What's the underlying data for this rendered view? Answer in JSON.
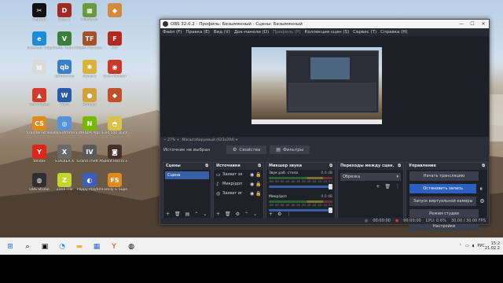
{
  "desktop": {
    "icons": [
      {
        "label": "CapCut",
        "color": "#111111",
        "glyph": "✂"
      },
      {
        "label": "Dota 2",
        "color": "#a02a23",
        "glyph": "D"
      },
      {
        "label": "Minecraft",
        "color": "#6b9a3d",
        "glyph": "▦"
      },
      {
        "label": "",
        "color": "#d38a3e",
        "glyph": "◆"
      },
      {
        "label": "Microsoft Edge",
        "color": "#1d8bd6",
        "glyph": "e"
      },
      {
        "label": "Grand Theft Auto V",
        "color": "#3a7f3d",
        "glyph": "V"
      },
      {
        "label": "Team Fortress 2",
        "color": "#a5512a",
        "glyph": "TF"
      },
      {
        "label": "F2F",
        "color": "#b2291f",
        "glyph": "F"
      },
      {
        "label": "",
        "color": "#d9d9d9",
        "glyph": "▤"
      },
      {
        "label": "qBittorrent",
        "color": "#3b7fc9",
        "glyph": "qb"
      },
      {
        "label": "Музыка",
        "color": "#d8b23a",
        "glyph": "✱"
      },
      {
        "label": "Dice Monster",
        "color": "#c73a2a",
        "glyph": "◉"
      },
      {
        "label": "TeamViewer",
        "color": "#d13b2b",
        "glyph": "▲"
      },
      {
        "label": "Word",
        "color": "#2a5ba8",
        "glyph": "W"
      },
      {
        "label": "Bomber",
        "color": "#d2a23a",
        "glyph": "●"
      },
      {
        "label": "",
        "color": "#c04f2e",
        "glyph": "◆"
      },
      {
        "label": "Counter-Strike 2",
        "color": "#e08a1e",
        "glyph": "CS"
      },
      {
        "label": "360 Extreme Browser",
        "color": "#5a8fd9",
        "glyph": "◎"
      },
      {
        "label": "NVIDIA App",
        "color": "#76b900",
        "glyph": "N"
      },
      {
        "label": "Find 500 Ducks on",
        "color": "#d9c24a",
        "glyph": "◓"
      },
      {
        "label": "Yandex",
        "color": "#e1251b",
        "glyph": "Y"
      },
      {
        "label": "STALKER X",
        "color": "#6a6a6a",
        "glyph": "X"
      },
      {
        "label": "Grand Theft Auto IV",
        "color": "#5a5a5a",
        "glyph": "IV"
      },
      {
        "label": "Silent Horror Esc.",
        "color": "#4a2f2a",
        "glyph": "◙"
      },
      {
        "label": "OBS Studio",
        "color": "#302e31",
        "glyph": "◍"
      },
      {
        "label": "Zone Trix",
        "color": "#c4d62b",
        "glyph": "Z"
      },
      {
        "label": "Poppy Playtime",
        "color": "#3d5fb8",
        "glyph": "◐"
      },
      {
        "label": "Family Fi Supermark.",
        "color": "#e08a1e",
        "glyph": "FS"
      }
    ]
  },
  "obs": {
    "title": "OBS 32.0.2 - Профиль: Безымянный - Сцены: Безымянный",
    "menu": [
      "Файл (F)",
      "Правка (E)",
      "Вид (V)",
      "Док-панели (D)",
      "Профиль (P)",
      "Коллекция сцен (S)",
      "Сервис (T)",
      "Справка (H)"
    ],
    "zoom": "27%",
    "scale_label": "Масштабируемый (623x294)",
    "no_source": "Источник не выбран",
    "properties_label": "Свойства",
    "filters_label": "Фильтры",
    "scenes": {
      "title": "Сцены",
      "items": [
        "Сцена"
      ]
    },
    "sources": {
      "title": "Источники",
      "items": [
        {
          "name": "Захват эк",
          "icon": "🖵"
        },
        {
          "name": "Микр/доп",
          "icon": "🎤"
        },
        {
          "name": "Захват иг",
          "icon": "🎮"
        }
      ]
    },
    "mixer": {
      "title": "Микшер звука",
      "tracks": [
        {
          "name": "Звук раб. стола",
          "db": "0.0 dB"
        },
        {
          "name": "Микр/доп",
          "db": "0.0 dB"
        }
      ],
      "scale": "-60 -55 -50 -45 -40 -35 -30 -25 -20 -15 -10 -5 0"
    },
    "transitions": {
      "title": "Переходы между сцен.",
      "selected": "Обрезка"
    },
    "controls": {
      "title": "Управление",
      "buttons": [
        "Начать трансляцию",
        "Остановить запись",
        "Запуск виртуальной камеры",
        "Режим студии",
        "Настройки"
      ]
    },
    "status": {
      "rec_time": "00:00:00",
      "stream_time": "00:00:00",
      "cpu": "CPU: 0.6%",
      "fps": "30.00 / 30.00 FPS"
    }
  },
  "taskbar": {
    "lang": "РУС",
    "time": "15:2",
    "date": "21.02.2"
  }
}
